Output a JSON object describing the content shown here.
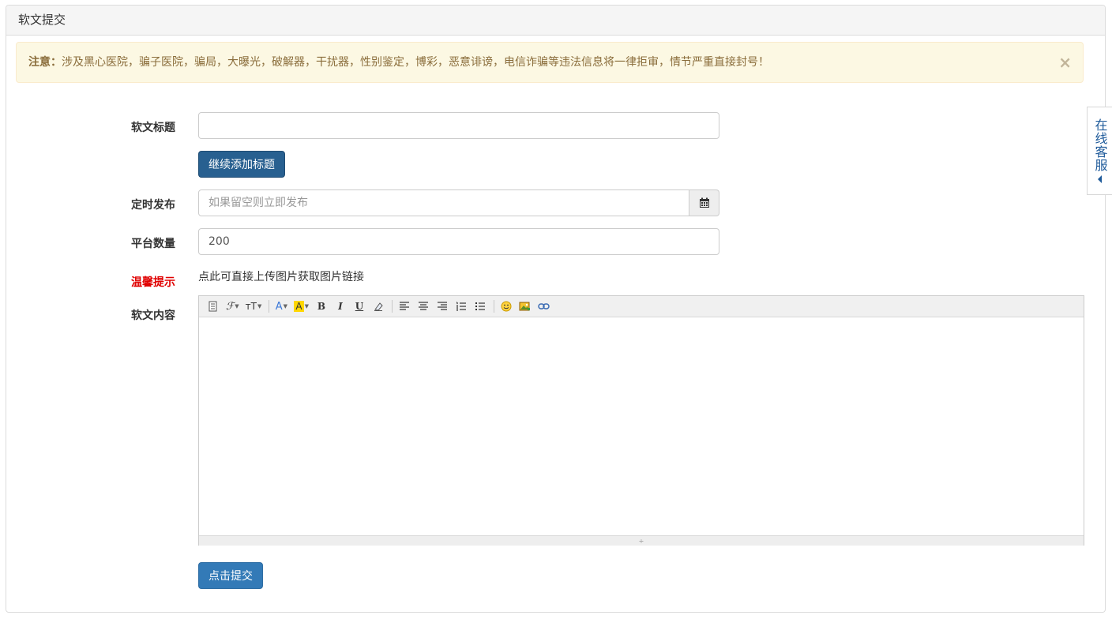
{
  "panel": {
    "title": "软文提交"
  },
  "alert": {
    "prefix": "注意：",
    "message": "涉及黑心医院，骗子医院，骗局，大曝光，破解器，干扰器，性别鉴定，博彩，恶意诽谤，电信诈骗等违法信息将一律拒审，情节严重直接封号！",
    "close_label": "×"
  },
  "form": {
    "title_label": "软文标题",
    "title_value": "",
    "add_title_button": "继续添加标题",
    "schedule_label": "定时发布",
    "schedule_placeholder": "如果留空则立即发布",
    "platform_label": "平台数量",
    "platform_value": "200",
    "tip_label": "温馨提示",
    "tip_text": "点此可直接上传图片获取图片链接",
    "content_label": "软文内容",
    "submit_button": "点击提交"
  },
  "editor": {
    "toolbar": [
      {
        "name": "source-icon",
        "glyph": "📋"
      },
      {
        "name": "font-family-icon",
        "glyph": "ℱ"
      },
      {
        "name": "font-size-icon",
        "glyph": "ᴛT"
      },
      {
        "name": "font-color-icon",
        "glyph": "A"
      },
      {
        "name": "highlight-color-icon",
        "glyph": "A"
      },
      {
        "name": "bold-icon",
        "glyph": "B"
      },
      {
        "name": "italic-icon",
        "glyph": "I"
      },
      {
        "name": "underline-icon",
        "glyph": "U"
      },
      {
        "name": "eraser-icon",
        "glyph": "⌫"
      },
      {
        "name": "align-left-icon",
        "glyph": "≡"
      },
      {
        "name": "align-center-icon",
        "glyph": "≡"
      },
      {
        "name": "align-right-icon",
        "glyph": "≡"
      },
      {
        "name": "ordered-list-icon",
        "glyph": "⋮≡"
      },
      {
        "name": "unordered-list-icon",
        "glyph": "⁝≡"
      },
      {
        "name": "emoticon-icon",
        "glyph": "☺"
      },
      {
        "name": "image-icon",
        "glyph": "🖼"
      },
      {
        "name": "link-icon",
        "glyph": "🔗"
      }
    ],
    "resize_glyph": "÷"
  },
  "side_service": {
    "label": "在线客服"
  },
  "colors": {
    "alert_bg": "#fcf8e3",
    "alert_text": "#8a6d3b",
    "primary": "#337ab7",
    "primary_dark": "#286090",
    "tip_red": "#e00000",
    "service_blue": "#1e5a9a"
  }
}
